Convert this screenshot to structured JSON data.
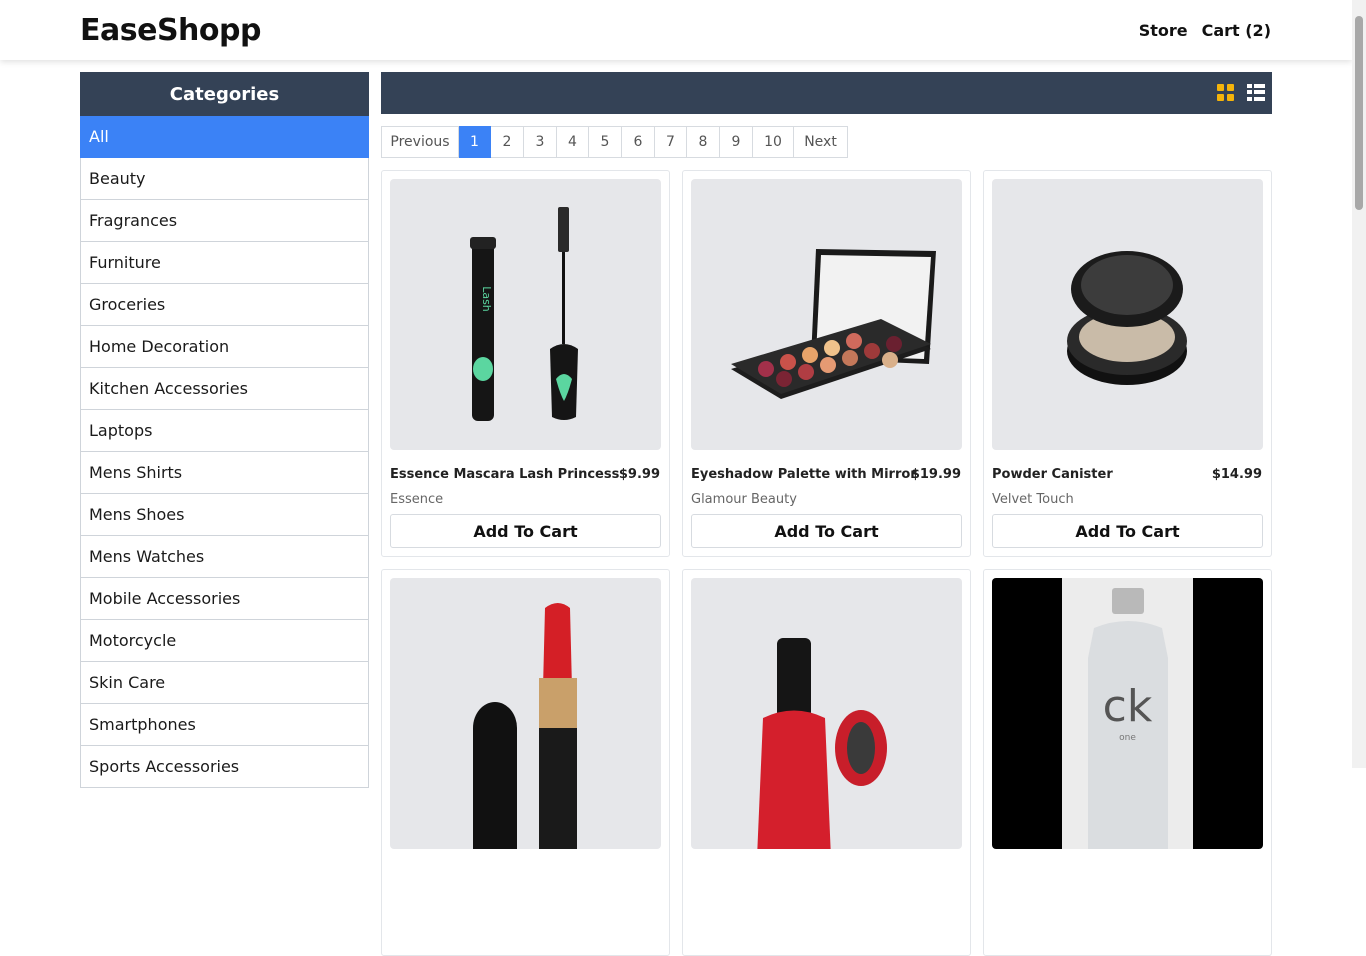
{
  "header": {
    "brand": "EaseShopp",
    "nav": [
      "Store",
      "Cart (2)"
    ]
  },
  "sidebar": {
    "title": "Categories",
    "items": [
      "All",
      "Beauty",
      "Fragrances",
      "Furniture",
      "Groceries",
      "Home Decoration",
      "Kitchen Accessories",
      "Laptops",
      "Mens Shirts",
      "Mens Shoes",
      "Mens Watches",
      "Mobile Accessories",
      "Motorcycle",
      "Skin Care",
      "Smartphones",
      "Sports Accessories"
    ],
    "active": "All"
  },
  "toolbar": {
    "view_icons": [
      "grid-view-icon",
      "list-view-icon"
    ],
    "active_view": "grid",
    "accent": "#f5b40a"
  },
  "pagination": {
    "previous": "Previous",
    "pages": [
      "1",
      "2",
      "3",
      "4",
      "5",
      "6",
      "7",
      "8",
      "9",
      "10"
    ],
    "next": "Next",
    "current": "1"
  },
  "products": [
    {
      "name": "Essence Mascara Lash Princess",
      "price": "$9.99",
      "brand": "Essence",
      "button": "Add To Cart",
      "image": "mascara"
    },
    {
      "name": "Eyeshadow Palette with Mirror",
      "price": "$19.99",
      "brand": "Glamour Beauty",
      "button": "Add To Cart",
      "image": "palette"
    },
    {
      "name": "Powder Canister",
      "price": "$14.99",
      "brand": "Velvet Touch",
      "button": "Add To Cart",
      "image": "powder"
    },
    {
      "name": "",
      "price": "",
      "brand": "",
      "button": "",
      "image": "lipstick"
    },
    {
      "name": "",
      "price": "",
      "brand": "",
      "button": "",
      "image": "nail-polish"
    },
    {
      "name": "",
      "price": "",
      "brand": "",
      "button": "",
      "image": "perfume-bottle",
      "image_text": [
        "ck",
        "one"
      ]
    }
  ],
  "colors": {
    "header_bg": "#344256",
    "active_blue": "#3b82f6",
    "card_bg": "#e6e7ea"
  }
}
